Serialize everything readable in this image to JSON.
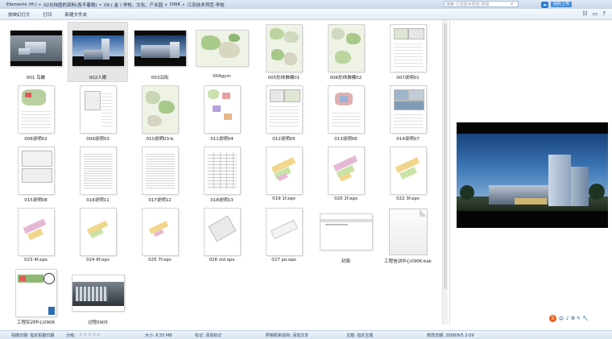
{
  "address": {
    "crumbs": [
      "Elements (H:)",
      "02光陆图的资料(各不着微)",
      "09 ( 金 ) 学校、文化、产业园",
      "DWK",
      "江苏技术师范-学校"
    ],
    "search_placeholder": "搜索 江苏技术师范-学校",
    "cloud_button": "拍照上传"
  },
  "toolbar": {
    "items": [
      "放映幻灯片",
      "打印",
      "新建文件夹"
    ]
  },
  "files": [
    {
      "name": "001 鸟瞰"
    },
    {
      "name": "002人眼"
    },
    {
      "name": "003沿街"
    },
    {
      "name": "004gym"
    },
    {
      "name": "005形体推模01"
    },
    {
      "name": "006形体推模02"
    },
    {
      "name": "007说明01"
    },
    {
      "name": "008说明02"
    },
    {
      "name": "009说明03"
    },
    {
      "name": "010说明03-b"
    },
    {
      "name": "011说明04"
    },
    {
      "name": "012说明05"
    },
    {
      "name": "013说明06"
    },
    {
      "name": "014说明07"
    },
    {
      "name": "015说明08"
    },
    {
      "name": "016说明11"
    },
    {
      "name": "017说明12"
    },
    {
      "name": "018说明13"
    },
    {
      "name": "019 1f.eps"
    },
    {
      "name": "020 2f.eps"
    },
    {
      "name": "022 3f.eps"
    },
    {
      "name": "023 4f.eps"
    },
    {
      "name": "024 6f.eps"
    },
    {
      "name": "025 7f.eps"
    },
    {
      "name": "026 sid.eps"
    },
    {
      "name": "027 po.eps"
    },
    {
      "name": "封面"
    },
    {
      "name": "工程信训中心0906.bak"
    },
    {
      "name": "工程实训中心0906"
    },
    {
      "name": "过程0905"
    }
  ],
  "ime": {
    "label": "中",
    "extra": "♪ ⚙ ✎ 🔧"
  },
  "status": {
    "created_label": "拍摄日期: 指定拍摄日期",
    "rating_label": "分级:",
    "rating_value": 0,
    "size": "大小: 8.55 MB",
    "tags": "标记: 添加标记",
    "caption": "照相机制造商: 添加文本",
    "theme": "主题: 指定主题",
    "modified": "修改日期: 2008/9/5 2:09"
  },
  "colors": {
    "accent": "#2a7fd0",
    "ime_logo": "#e95d1f",
    "chrome": "#dfe9f5"
  }
}
